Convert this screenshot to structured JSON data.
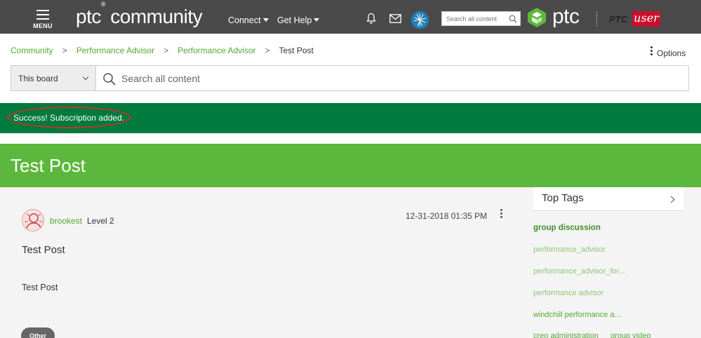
{
  "header": {
    "menu_label": "MENU",
    "logo_text": "ptc",
    "logo_reg": "®",
    "logo_community": " community",
    "nav": [
      "Connect",
      "Get Help"
    ],
    "search_placeholder": "Search all content",
    "brand_text": "ptc",
    "ptcuser_ptc": "PTC",
    "ptcuser_user": "user"
  },
  "breadcrumb": {
    "items": [
      "Community",
      "Performance Advisor",
      "Performance Advisor"
    ],
    "separator": ">",
    "current": "Test Post"
  },
  "options_label": "Options",
  "search": {
    "scope": "This board",
    "placeholder": "Search all content"
  },
  "banner": {
    "message": "Success! Subscription added."
  },
  "page_title": "Test Post",
  "post": {
    "author": "brookest",
    "level": "Level 2",
    "date": "12-31-2018 01:35 PM",
    "title": "Test Post",
    "body": "Test Post",
    "tag": "Other"
  },
  "sidebar": {
    "title": "Top Tags",
    "tags": [
      "group discussion",
      "performance_advisor",
      "performance_advisor_for...",
      "performance advisor",
      "windchill performance a...",
      "creo administration",
      "group video"
    ]
  },
  "colors": {
    "nav_bg": "#4a4a4a",
    "link_green": "#57a636",
    "success_bg": "#007a3d",
    "title_bg": "#5cb83c",
    "annotation_red": "#c8302b"
  }
}
